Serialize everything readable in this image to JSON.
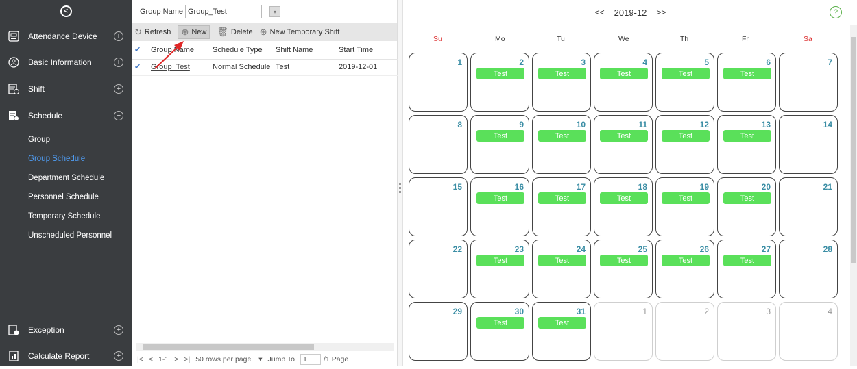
{
  "sidebar": {
    "menus": [
      {
        "label": "Attendance Device",
        "toggle": "+",
        "icon": "device-icon"
      },
      {
        "label": "Basic Information",
        "toggle": "+",
        "icon": "info-icon"
      },
      {
        "label": "Shift",
        "toggle": "+",
        "icon": "shift-icon"
      },
      {
        "label": "Schedule",
        "toggle": "−",
        "icon": "schedule-icon"
      },
      {
        "label": "Exception",
        "toggle": "+",
        "icon": "exception-icon"
      },
      {
        "label": "Calculate Report",
        "toggle": "+",
        "icon": "report-icon"
      }
    ],
    "sub_items": [
      "Group",
      "Group Schedule",
      "Department Schedule",
      "Personnel Schedule",
      "Temporary Schedule",
      "Unscheduled Personnel"
    ],
    "active_sub": "Group Schedule"
  },
  "filter": {
    "label": "Group Name",
    "value": "Group_Test"
  },
  "toolbar": {
    "refresh": "Refresh",
    "new": "New",
    "delete": "Delete",
    "new_temp": "New Temporary Shift"
  },
  "table": {
    "headers": [
      "Group Name",
      "Schedule Type",
      "Shift Name",
      "Start Time"
    ],
    "rows": [
      [
        "Group_Test",
        "Normal Schedule",
        "Test",
        "2019-12-01"
      ]
    ]
  },
  "pager": {
    "range": "1-1",
    "rows_per_page": "50 rows per page",
    "jump_label": "Jump To",
    "page": "1",
    "total": "/1 Page"
  },
  "calendar": {
    "prev": "<<",
    "next": ">>",
    "month": "2019-12",
    "help": "?",
    "weekdays": [
      "Su",
      "Mo",
      "Tu",
      "We",
      "Th",
      "Fr",
      "Sa"
    ],
    "weeks": [
      [
        {
          "d": "1"
        },
        {
          "d": "2",
          "s": "Test"
        },
        {
          "d": "3",
          "s": "Test"
        },
        {
          "d": "4",
          "s": "Test"
        },
        {
          "d": "5",
          "s": "Test"
        },
        {
          "d": "6",
          "s": "Test"
        },
        {
          "d": "7"
        }
      ],
      [
        {
          "d": "8"
        },
        {
          "d": "9",
          "s": "Test"
        },
        {
          "d": "10",
          "s": "Test"
        },
        {
          "d": "11",
          "s": "Test"
        },
        {
          "d": "12",
          "s": "Test"
        },
        {
          "d": "13",
          "s": "Test"
        },
        {
          "d": "14"
        }
      ],
      [
        {
          "d": "15"
        },
        {
          "d": "16",
          "s": "Test"
        },
        {
          "d": "17",
          "s": "Test"
        },
        {
          "d": "18",
          "s": "Test"
        },
        {
          "d": "19",
          "s": "Test"
        },
        {
          "d": "20",
          "s": "Test"
        },
        {
          "d": "21"
        }
      ],
      [
        {
          "d": "22"
        },
        {
          "d": "23",
          "s": "Test"
        },
        {
          "d": "24",
          "s": "Test"
        },
        {
          "d": "25",
          "s": "Test"
        },
        {
          "d": "26",
          "s": "Test"
        },
        {
          "d": "27",
          "s": "Test"
        },
        {
          "d": "28"
        }
      ],
      [
        {
          "d": "29"
        },
        {
          "d": "30",
          "s": "Test"
        },
        {
          "d": "31",
          "s": "Test"
        },
        {
          "d": "1",
          "o": true
        },
        {
          "d": "2",
          "o": true
        },
        {
          "d": "3",
          "o": true
        },
        {
          "d": "4",
          "o": true
        }
      ]
    ]
  },
  "colors": {
    "sidebar": "#3a3d40",
    "active": "#4f9bf0",
    "shift": "#5ae05a",
    "weekend": "#dd3333"
  }
}
